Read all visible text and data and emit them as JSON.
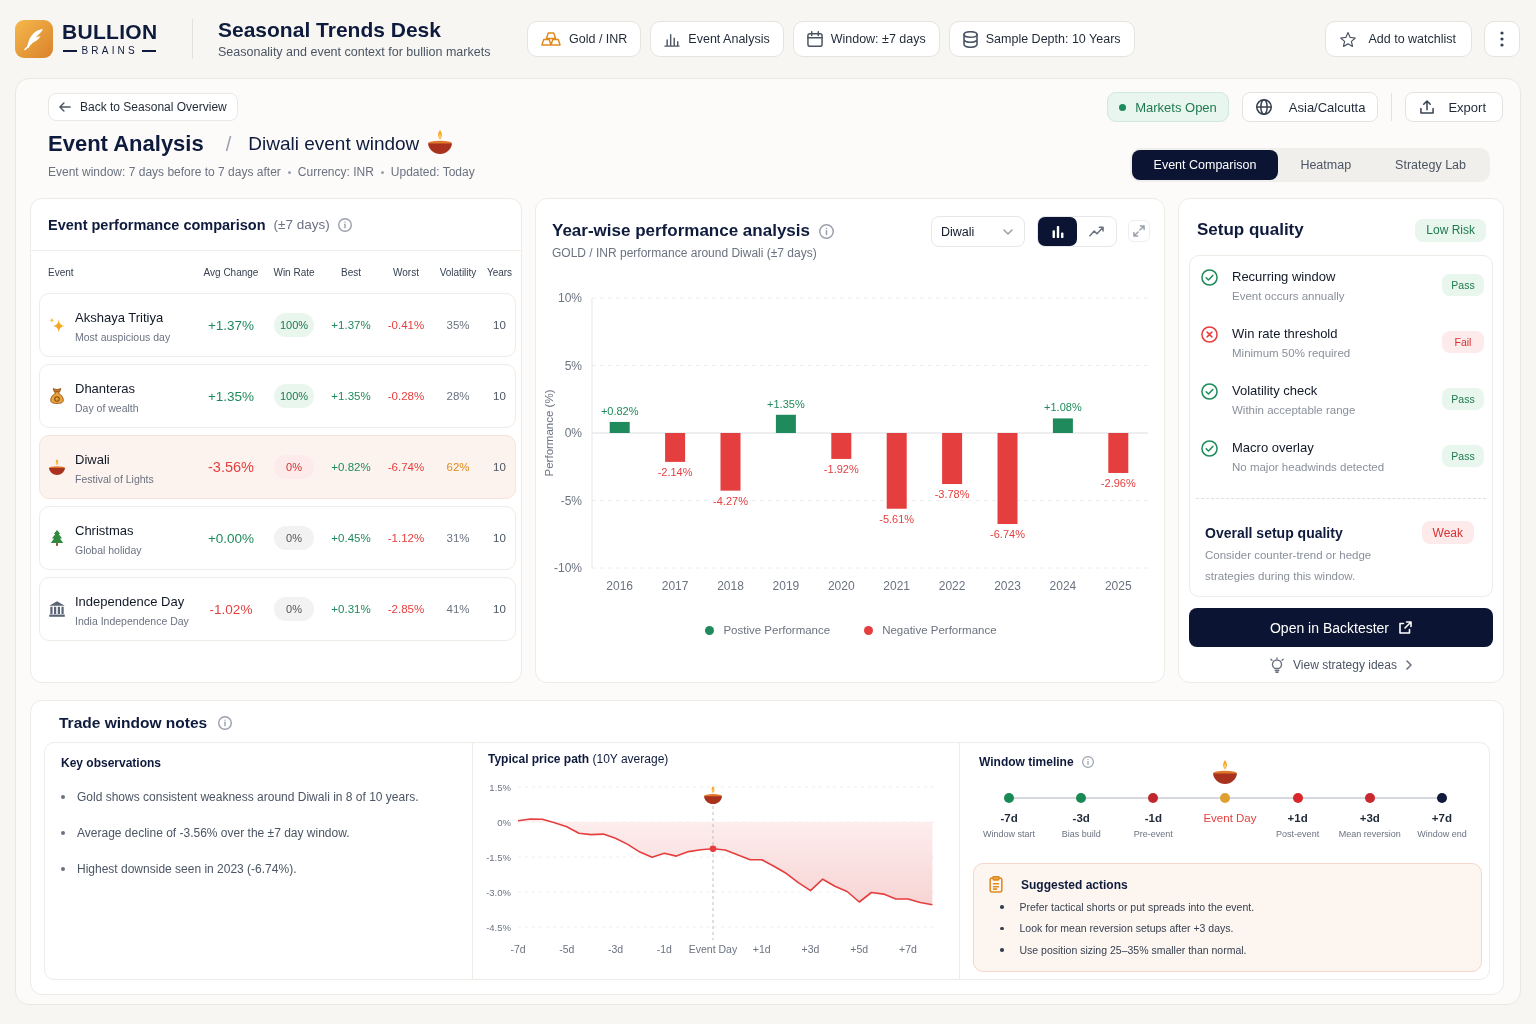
{
  "brand": {
    "name": "BULLION",
    "tagline": "BRAINS"
  },
  "header": {
    "title": "Seasonal Trends Desk",
    "subtitle": "Seasonality and event context for bullion markets"
  },
  "context_chips": [
    {
      "label": "Gold / INR"
    },
    {
      "label": "Event Analysis"
    },
    {
      "label": "Window: ±7 days"
    },
    {
      "label": "Sample Depth: 10 Years"
    }
  ],
  "watchlist_button": {
    "label": "Add to watchlist"
  },
  "back_link": {
    "label": "Back to Seasonal Overview"
  },
  "market_status": {
    "label": "Markets Open",
    "open": true
  },
  "timezone": {
    "label": "Asia/Calcutta"
  },
  "export_button": {
    "label": "Export"
  },
  "page": {
    "title": "Event Analysis",
    "separator": "/",
    "subtitle": "Diwali event window",
    "meta": [
      "Event window: 7 days before to 7 days after",
      "Currency: INR",
      "Updated: Today"
    ]
  },
  "view_tabs": [
    {
      "label": "Event Comparison",
      "selected": true
    },
    {
      "label": "Heatmap",
      "selected": false
    },
    {
      "label": "Strategy Lab",
      "selected": false
    }
  ],
  "comparison": {
    "title": "Event performance comparison",
    "note": "(±7 days)",
    "columns": [
      "Event",
      "Avg Change",
      "Win Rate",
      "Best",
      "Worst",
      "Volatility",
      "Years"
    ],
    "rows": [
      {
        "event": "Akshaya Tritiya",
        "description": "Most auspicious day",
        "avg_change": {
          "value": "+1.37%",
          "negative": false
        },
        "win_rate": {
          "value": "100%",
          "passed": true
        },
        "best": "+1.37%",
        "worst": "-0.41%",
        "volatility": {
          "value": "35%",
          "high": false
        },
        "years": "10",
        "selected": false
      },
      {
        "event": "Dhanteras",
        "description": "Day of wealth",
        "avg_change": {
          "value": "+1.35%",
          "negative": false
        },
        "win_rate": {
          "value": "100%",
          "passed": true
        },
        "best": "+1.35%",
        "worst": "-0.28%",
        "volatility": {
          "value": "28%",
          "high": false
        },
        "years": "10",
        "selected": false
      },
      {
        "event": "Diwali",
        "description": "Festival of Lights",
        "avg_change": {
          "value": "-3.56%",
          "negative": true
        },
        "win_rate": {
          "value": "0%",
          "passed": false
        },
        "best": "+0.82%",
        "worst": "-6.74%",
        "volatility": {
          "value": "62%",
          "high": true
        },
        "years": "10",
        "selected": true
      },
      {
        "event": "Christmas",
        "description": "Global holiday",
        "avg_change": {
          "value": "+0.00%",
          "negative": false
        },
        "win_rate": {
          "value": "0%",
          "passed": false
        },
        "best": "+0.45%",
        "worst": "-1.12%",
        "volatility": {
          "value": "31%",
          "high": false
        },
        "years": "10",
        "selected": false
      },
      {
        "event": "Independence Day",
        "description": "India Independence Day",
        "avg_change": {
          "value": "-1.02%",
          "negative": true
        },
        "win_rate": {
          "value": "0%",
          "passed": false
        },
        "best": "+0.31%",
        "worst": "-2.85%",
        "volatility": {
          "value": "41%",
          "high": false
        },
        "years": "10",
        "selected": false
      }
    ]
  },
  "yearwise": {
    "title": "Year-wise performance analysis",
    "subtitle": "GOLD / INR performance around Diwali (±7 days)",
    "event_select": {
      "value": "Diwali"
    },
    "chart_types": [
      {
        "kind": "bar",
        "selected": true
      },
      {
        "kind": "line",
        "selected": false
      }
    ],
    "chart_data": {
      "type": "bar",
      "ylabel": "Performance (%)",
      "categories": [
        "2016",
        "2017",
        "2018",
        "2019",
        "2020",
        "2021",
        "2022",
        "2023",
        "2024",
        "2025"
      ],
      "series": [
        {
          "name": "Postive Performance",
          "color": "#1f8a5b",
          "values": [
            0.82,
            null,
            null,
            1.35,
            null,
            null,
            null,
            null,
            1.08,
            null
          ],
          "value_labels": [
            "+0.82%",
            null,
            null,
            "+1.35%",
            null,
            null,
            null,
            null,
            "+1.08%",
            null
          ]
        },
        {
          "name": "Negative Performance",
          "color": "#e53e3e",
          "values": [
            null,
            -2.14,
            -4.27,
            null,
            -1.92,
            -5.61,
            -3.78,
            -6.74,
            null,
            -2.96
          ],
          "value_labels": [
            null,
            "-2.14%",
            "-4.27%",
            null,
            "-1.92%",
            "-5.61%",
            "-3.78%",
            "-6.74%",
            null,
            "-2.96%"
          ]
        }
      ],
      "ylim": [
        -10,
        10
      ],
      "yticks": [
        {
          "value": 10,
          "label": "10%"
        },
        {
          "value": 5,
          "label": "5%"
        },
        {
          "value": 0,
          "label": "0%"
        },
        {
          "value": -5,
          "label": "-5%"
        },
        {
          "value": -10,
          "label": "-10%"
        }
      ],
      "grid": true
    }
  },
  "setup_quality": {
    "title": "Setup quality",
    "risk_badge": {
      "label": "Low Risk",
      "warning": false
    },
    "checks": [
      {
        "title": "Recurring window",
        "description": "Event occurs annually",
        "passed": true,
        "badge": "Pass"
      },
      {
        "title": "Win rate threshold",
        "description": "Minimum 50% required",
        "passed": false,
        "badge": "Fail"
      },
      {
        "title": "Volatility check",
        "description": "Within acceptable range",
        "passed": true,
        "badge": "Pass"
      },
      {
        "title": "Macro overlay",
        "description": "No major headwinds detected",
        "passed": true,
        "badge": "Pass"
      }
    ],
    "overall": {
      "title": "Overall setup quality",
      "badge": {
        "label": "Weak",
        "warning": true
      },
      "description": "Consider counter-trend or hedge strategies during this window."
    },
    "primary_action": "Open in Backtester",
    "secondary_link": "View strategy ideas"
  },
  "trade_notes": {
    "title": "Trade window notes",
    "observations": {
      "title": "Key observations",
      "items": [
        "Gold shows consistent weakness around Diwali in 8 of 10 years.",
        "Average decline of -3.56% over the ±7 day window.",
        "Highest downside seen in 2023 (-6.74%)."
      ]
    },
    "price_path": {
      "title": "**Typical price path** (10Y average)",
      "chart_data": {
        "type": "area",
        "categories": [
          "-7d",
          null,
          null,
          null,
          "-5d",
          null,
          null,
          null,
          "-3d",
          null,
          null,
          null,
          "-1d",
          null,
          null,
          null,
          "Event Day",
          null,
          null,
          null,
          "+1d",
          null,
          null,
          null,
          "+3d",
          null,
          null,
          null,
          "+5d",
          null,
          null,
          null,
          "+7d",
          null,
          null
        ],
        "values": [
          0.05,
          0.13,
          0.12,
          -0.03,
          -0.2,
          -0.48,
          -0.54,
          -0.52,
          -0.7,
          -0.96,
          -1.29,
          -1.51,
          -1.34,
          -1.46,
          -1.27,
          -1.19,
          -1.15,
          -1.2,
          -1.4,
          -1.61,
          -1.62,
          -1.9,
          -2.2,
          -2.6,
          -2.94,
          -2.45,
          -2.75,
          -2.98,
          -3.43,
          -3.02,
          -3.09,
          -3.3,
          -3.3,
          -3.45,
          -3.55
        ],
        "ylim": [
          -4.5,
          1.5
        ],
        "yticks": [
          {
            "value": 1.5,
            "label": "1.5%"
          },
          {
            "value": 0,
            "label": "0%"
          },
          {
            "value": -1.5,
            "label": "-1.5%"
          },
          {
            "value": -3,
            "label": "-3.0%"
          },
          {
            "value": -4.5,
            "label": "-4.5%"
          }
        ],
        "grid": true,
        "ref_lines": [
          {
            "axis": "x",
            "value": "Event Day"
          }
        ]
      }
    },
    "timeline": {
      "title": "Window timeline",
      "steps": [
        {
          "label": "-7d",
          "caption": "Window start",
          "color": "#1a8a55",
          "kind": "step"
        },
        {
          "label": "-3d",
          "caption": "Bias build",
          "color": "#1a8a55",
          "kind": "step"
        },
        {
          "label": "-1d",
          "caption": "Pre-event",
          "color": "#c0282d",
          "kind": "step"
        },
        {
          "label": "Event Day",
          "color": "#e0a030",
          "kind": "event"
        },
        {
          "label": "+1d",
          "caption": "Post-event",
          "color": "#d9262b",
          "kind": "step"
        },
        {
          "label": "+3d",
          "caption": "Mean reversion",
          "color": "#c8282e",
          "kind": "step"
        },
        {
          "label": "+7d",
          "caption": "Window end",
          "color": "#101a3a",
          "kind": "step"
        }
      ]
    },
    "suggested_actions": {
      "title": "Suggested actions",
      "items": [
        "Prefer tactical shorts or put spreads into the event.",
        "Look for mean reversion setups after +3 days.",
        "Use position sizing 25–35% smaller than normal."
      ]
    }
  }
}
